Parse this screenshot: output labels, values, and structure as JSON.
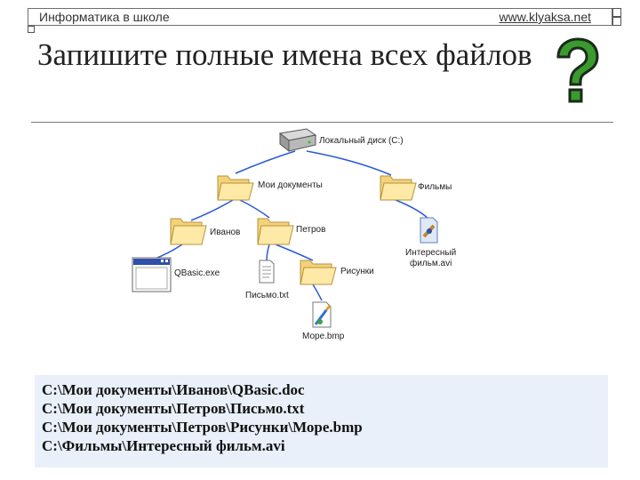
{
  "header": {
    "left_text": "Информатика в школе",
    "right_text": "www.klyaksa.net"
  },
  "title": "Запишите полные имена всех файлов",
  "question_icon": "question-mark-icon",
  "tree": {
    "disk": "Локальный диск (C:)",
    "my_docs": "Мои документы",
    "films": "Фильмы",
    "ivanov": "Иванов",
    "petrov": "Петров",
    "qbasic": "QBasic.exe",
    "pismo": "Письмо.txt",
    "risunki": "Рисунки",
    "film_file_line1": "Интересный",
    "film_file_line2": "фильм.avi",
    "more": "Море.bmp"
  },
  "answers": [
    "C:\\Мои документы\\Иванов\\QBasic.doc",
    "C:\\Мои документы\\Петров\\Письмо.txt",
    "C:\\Мои документы\\Петров\\Рисунки\\Море.bmp",
    "C:\\Фильмы\\Интересный фильм.avi"
  ],
  "colors": {
    "line_color": "#2a5bd7",
    "folder_color": "#f3d27a",
    "answer_bg": "#e9f0fa"
  }
}
